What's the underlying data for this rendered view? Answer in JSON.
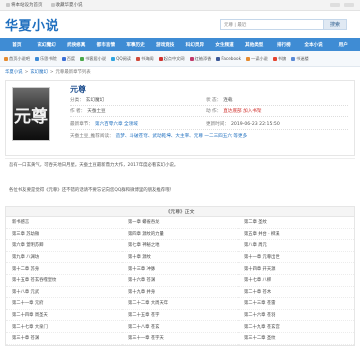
{
  "topbar": {
    "links": [
      {
        "label": "将本站设为首页",
        "icon": "home-icon"
      },
      {
        "label": "收藏华夏小说",
        "icon": "star-icon"
      }
    ]
  },
  "header": {
    "logo": "华夏小说",
    "search_placeholder": "元尊 | 最近",
    "search_button": "搜索"
  },
  "nav": [
    "首页",
    "玄幻魔幻",
    "武侠修真",
    "都市言情",
    "军事历史",
    "游戏竞技",
    "科幻灵异",
    "女生频道",
    "其他类型",
    "排行榜",
    "全本小说",
    "用户"
  ],
  "friendbar": [
    {
      "label": "首页小说吧",
      "color": "#e58a2e"
    },
    {
      "label": "乐思书院",
      "color": "#3b8ad6"
    },
    {
      "label": "百度",
      "color": "#3b6fd6"
    },
    {
      "label": "书客居小说",
      "color": "#4aa84a"
    },
    {
      "label": "QQ阅读",
      "color": "#2fa4e0"
    },
    {
      "label": "书海阁",
      "color": "#d04a3a"
    },
    {
      "label": "起点中文网",
      "color": "#d0312d"
    },
    {
      "label": "红袖添香",
      "color": "#c23a6b"
    },
    {
      "label": "Facebook",
      "color": "#3b5998"
    },
    {
      "label": "一读小说",
      "color": "#e58a2e"
    },
    {
      "label": "书旗",
      "color": "#e5432e"
    },
    {
      "label": "书迷楼",
      "color": "#5a8ad6"
    }
  ],
  "breadcrumb": [
    "华夏小说",
    "玄幻魔幻",
    "元尊最新章节列表"
  ],
  "book": {
    "cover_glyph": "元尊",
    "title": "元尊",
    "category_label": "分类：",
    "category": "玄幻魔幻",
    "status_label": "状    态：",
    "status": "连载",
    "author_label": "作    者：",
    "author": "天蚕土豆",
    "action_label": "动    作：",
    "action_read": "直达底部",
    "action_shelf": "加入书架",
    "latest_label": "最新章节：",
    "latest": "第六百零六章 全领域",
    "updated_label": "更新时间：",
    "updated": "2019-06-23 22:15:50",
    "others_label": "天蚕土豆_推荐阅读：",
    "others": "造梦、斗破苍穹、武动乾坤、大主宰、元尊 一二三四五六 等更多"
  },
  "intro": {
    "line1": "吾有一口玄黄气，可吞天地日月星。天蚕土豆最新鼎力大作，2017年度必看玄幻小说。",
    "line2": ""
  },
  "tip": "各位书友要是觉得《元尊》还不错的话请不要忘记向您QQ群和微博里的朋友推荐哦！",
  "chapters": {
    "title": "《元尊》正文",
    "items": [
      "新书感言",
      "第一章 蟒雀吞龙",
      "第二章 圣纹",
      "第三章 苏幼微",
      "第四章 源纹的力量",
      "第五章 井台 · 柳溪",
      "第六章 萱明苏卿",
      "第七章 神秘之地",
      "第八章 周元",
      "第九章 八渊坊",
      "第十章 源纹",
      "第十一章 元尊出世",
      "第十二章 苏身",
      "第十三章 冲脉",
      "第十四章 开天源",
      "第十五章 苍玄吞噬皇纹",
      "第十六章 苍渊",
      "第十七章 八柳",
      "第十八章 元武",
      "第十九章 并身",
      "第二十章 苍木",
      "第二十一章 元府",
      "第二十二章 大周天年",
      "第二十三章 苍雷",
      "第二十四章 周圣天",
      "第二十五章 苍宇",
      "第二十六章 苍羽",
      "第二十七章 大泉门",
      "第二十八章 苍玄",
      "第二十九章 苍玄宫",
      "第三十章 苍渊",
      "第三十一章 苍宇天",
      "第三十二章 圣纹"
    ]
  }
}
